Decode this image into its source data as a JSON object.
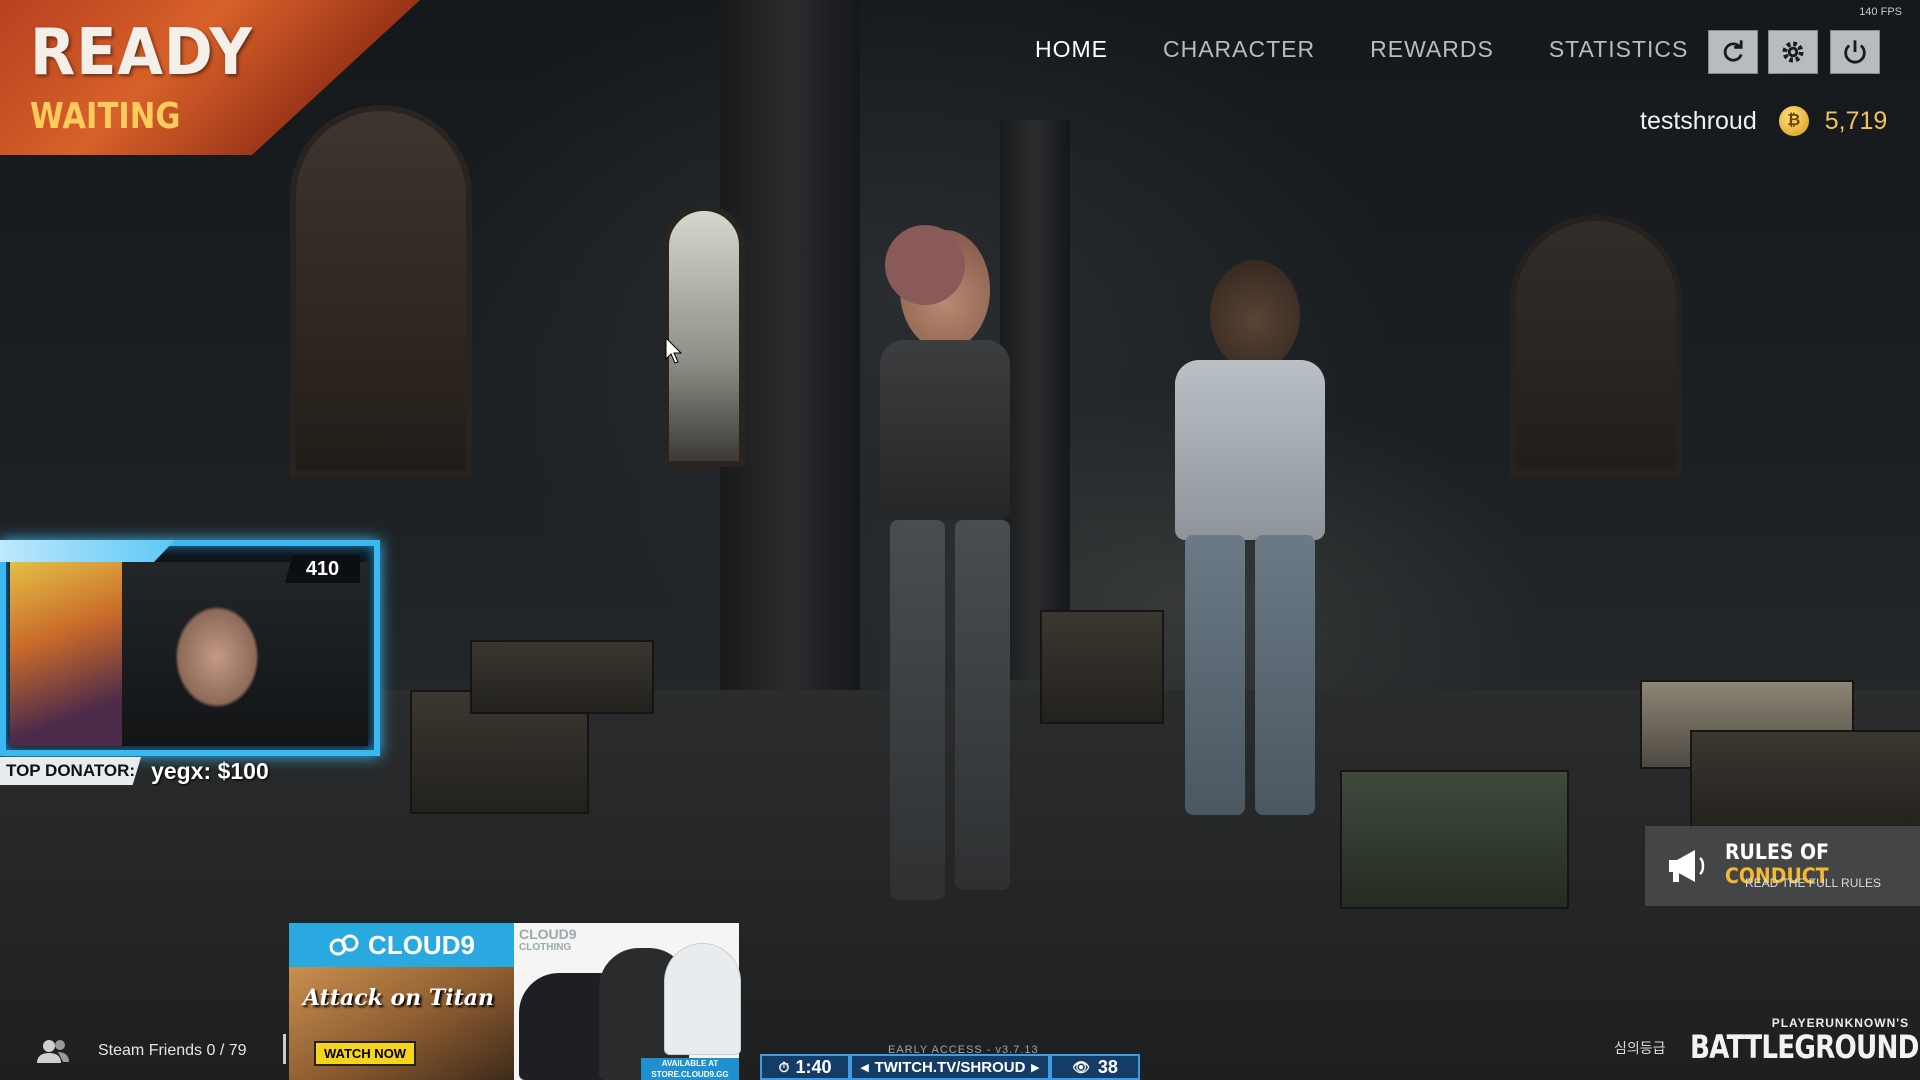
{
  "status": {
    "title": "READY",
    "subtitle": "WAITING"
  },
  "nav": {
    "tabs": [
      "HOME",
      "CHARACTER",
      "REWARDS",
      "STATISTICS"
    ],
    "active": "HOME"
  },
  "fps": "140 FPS",
  "user": {
    "name": "testshroud",
    "coins": "5,719"
  },
  "webcam": {
    "count": "410"
  },
  "donator": {
    "label": "TOP DONATOR:",
    "value": "yegx: $100"
  },
  "sponsor": {
    "brand": "CLOUD9",
    "clothing": [
      "CLOUD9",
      "CLOTHING"
    ],
    "show": "Attack on Titan",
    "cta": "WATCH NOW",
    "store": [
      "AVAILABLE AT",
      "STORE.CLOUD9.GG"
    ]
  },
  "friends": {
    "label": "Steam Friends 0 / 79"
  },
  "build": "EARLY ACCESS - v3.7.13",
  "ticker": {
    "timer": "1:40",
    "url": "TWITCH.TV/SHROUD",
    "viewers": "38"
  },
  "rules": {
    "title_a": "RULES OF",
    "title_b": "CONDUCT",
    "subtitle": "READ THE FULL RULES"
  },
  "rating": "심의등급",
  "logo": {
    "small": "PLAYERUNKNOWN'S",
    "big": "BATTLEGROUNDS"
  },
  "colors": {
    "accent": "#f1c35a",
    "banner": "#d8612a",
    "webcam_border": "#3bb8f0",
    "cloud9": "#29a9e0"
  },
  "icons": [
    "refresh-icon",
    "settings-icon",
    "power-icon",
    "coin-icon",
    "friends-icon",
    "megaphone-icon",
    "cursor-icon"
  ]
}
